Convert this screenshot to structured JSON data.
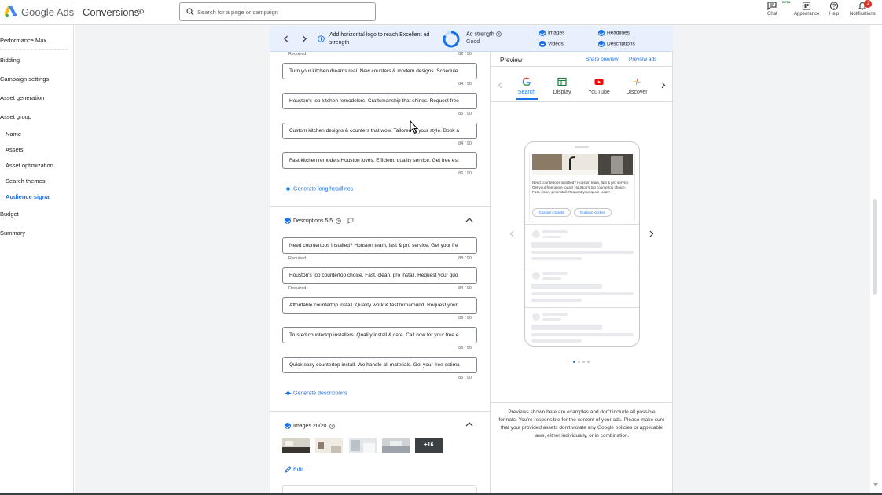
{
  "topbar": {
    "brand": "Google Ads",
    "page_name": "Conversions",
    "search_placeholder": "Search for a page or campaign",
    "chat_label": "Chat",
    "beta_label": "BETA",
    "appearance_label": "Appearance",
    "help_label": "Help",
    "notifications_label": "Notifications",
    "notifications_count": "1",
    "brand_colors": [
      "#4285f4",
      "#34a853",
      "#fbbc04"
    ]
  },
  "nav": {
    "performance_max": "Performance Max",
    "bidding": "Bidding",
    "campaign_settings": "Campaign settings",
    "asset_generation": "Asset generation",
    "asset_group": "Asset group",
    "name": "Name",
    "assets": "Assets",
    "asset_optimization": "Asset optimization",
    "search_themes": "Search themes",
    "audience_signal": "Audience signal",
    "budget": "Budget",
    "summary": "Summary"
  },
  "banner": {
    "message": "Add horizontal logo to reach Excellent ad strength",
    "strength_label": "Ad strength",
    "strength_value": "Good",
    "checks": {
      "images": "Images",
      "videos": "Videos",
      "headlines": "Headlines",
      "descriptions": "Descriptions"
    }
  },
  "long_headlines": {
    "top_required": "Required",
    "top_count": "82 / 90",
    "items": [
      {
        "text": "Turn your kitchen dreams real. New counters & modern designs. Schedule",
        "count": "84 / 90"
      },
      {
        "text": "Houston's top kitchen remodelers. Craftsmanship that shines. Request free",
        "count": "85 / 90"
      },
      {
        "text": "Custom kitchen designs & counters that wow. Tailored to your style. Book a",
        "count": "84 / 90"
      },
      {
        "text": "Fast kitchen remodels Houston loves. Efficient, quality service. Get free est",
        "count": "86 / 90"
      }
    ],
    "generate_label": "Generate long headlines"
  },
  "descriptions": {
    "title": "Descriptions 5/5",
    "items": [
      {
        "text": "Need countertops installed? Houston team, fast & pro service. Get your fre",
        "required": "Required",
        "count": "88 / 90"
      },
      {
        "text": "Houston's top countertop choice. Fast, clean, pro install. Request your quo",
        "required": "Required",
        "count": "84 / 90"
      },
      {
        "text": "Affordable countertop install. Quality work & fast turnaround. Request your",
        "required": "",
        "count": "86 / 90"
      },
      {
        "text": "Trusted countertop installers. Quality install & care. Call now for your free e",
        "required": "",
        "count": "86 / 90"
      },
      {
        "text": "Quick easy countertop install. We handle all materials. Get your free estima",
        "required": "",
        "count": "85 / 90"
      }
    ],
    "generate_label": "Generate descriptions"
  },
  "images": {
    "title": "Images 20/20",
    "more_label": "+16",
    "edit_label": "Edit"
  },
  "preview": {
    "title": "Preview",
    "share_label": "Share preview",
    "preview_ads_label": "Preview ads",
    "tabs": [
      "Search",
      "Display",
      "YouTube",
      "Discover"
    ],
    "selected_tab": "Search",
    "ad_text": "Need countertops installed? Houston team, fast & pro service. Get your free quote today! Houston's top countertop choice. Fast, clean, pro install. Request your quote today!",
    "chips": [
      "Custom Closets",
      "Outdoor Kitchen"
    ],
    "disclaimer": "Previews shown here are examples and don't include all possible formats. You're responsible for the content of your ads. Please make sure that your provided assets don't violate any Google policies or applicable laws, either individually, or in combination."
  }
}
